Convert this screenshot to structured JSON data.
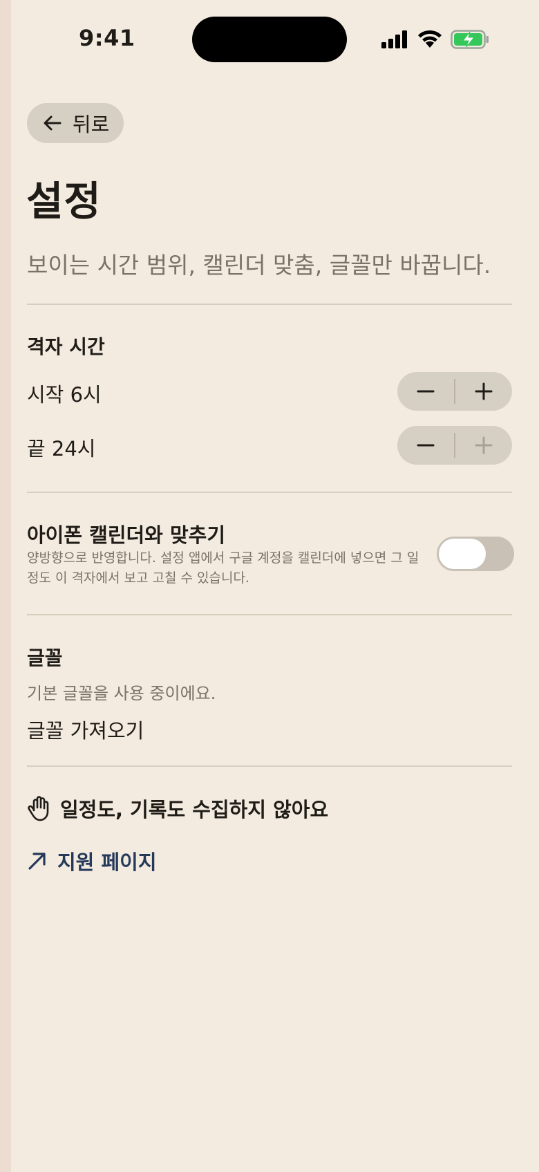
{
  "status_bar": {
    "time": "9:41"
  },
  "back": {
    "label": "뒤로"
  },
  "page": {
    "title": "설정",
    "subtitle": "보이는 시간 범위, 캘린더 맞춤, 글꼴만 바꿉니다."
  },
  "grid_time": {
    "title": "격자 시간",
    "start_label": "시작 6시",
    "end_label": "끝 24시",
    "end_plus_disabled": true
  },
  "calendar_sync": {
    "title": "아이폰 캘린더와 맞추기",
    "description": "양방향으로 반영합니다. 설정 앱에서 구글 계정을 캘린더에 넣으면 그 일정도 이 격자에서 보고 고칠 수 있습니다.",
    "enabled": false
  },
  "font": {
    "title": "글꼴",
    "description": "기본 글꼴을 사용 중이에요.",
    "import_label": "글꼴 가져오기"
  },
  "privacy": {
    "label": "일정도, 기록도 수집하지 않아요",
    "icon": "hand-icon"
  },
  "support": {
    "label": "지원 페이지",
    "icon": "arrow-up-right-icon"
  },
  "colors": {
    "background": "#f3ebe0",
    "control": "#d6cfc3",
    "link": "#253a5a",
    "battery": "#34c759"
  }
}
